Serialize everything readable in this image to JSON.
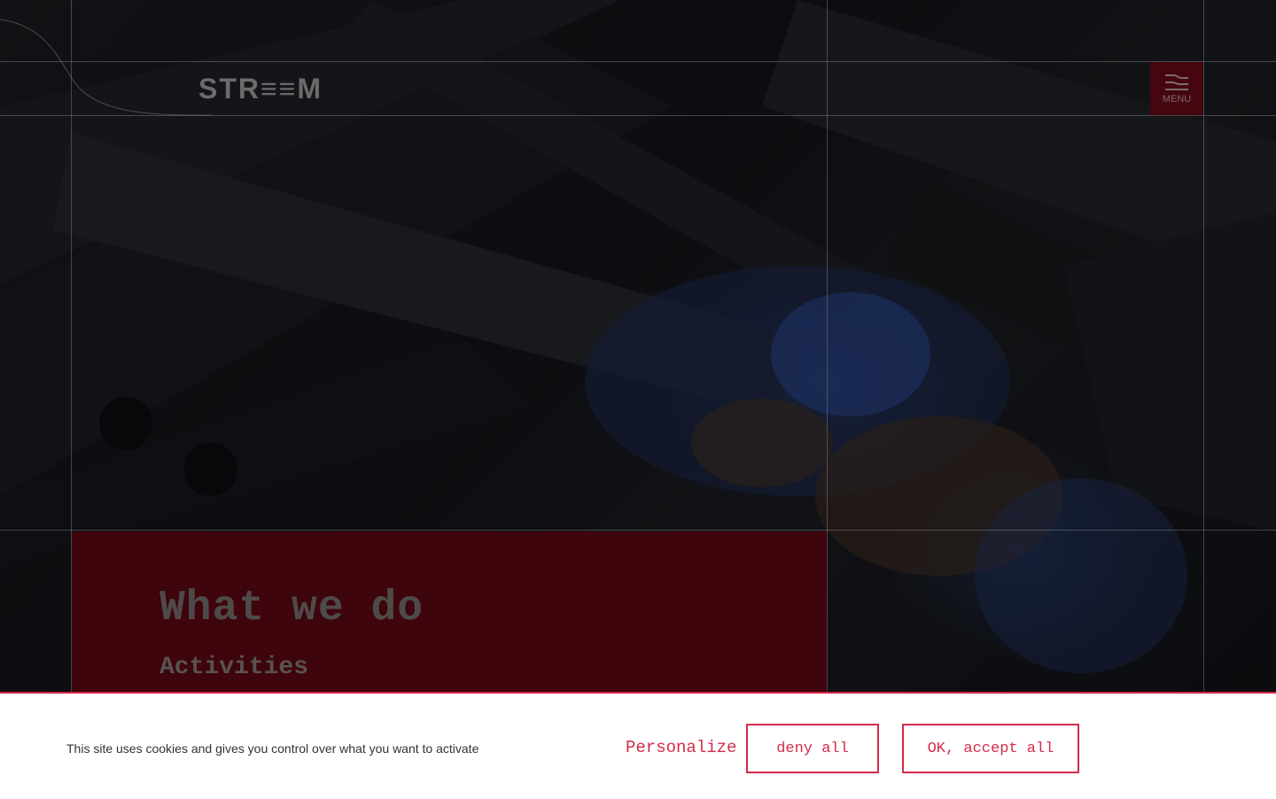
{
  "header": {
    "logo_text": "STR≡≡M",
    "menu_label": "MENU"
  },
  "hero": {
    "title": "What we do",
    "subtitle": "Activities"
  },
  "cookies": {
    "message": "This site uses cookies and gives you control over what you want to activate",
    "personalize_label": "Personalize",
    "deny_label": "deny all",
    "accept_label": "OK, accept all"
  },
  "colors": {
    "accent": "#d42b4b",
    "panel": "#3e050d",
    "menu_bg": "#45060f"
  },
  "icons": {
    "menu": "hamburger-wave-icon"
  }
}
